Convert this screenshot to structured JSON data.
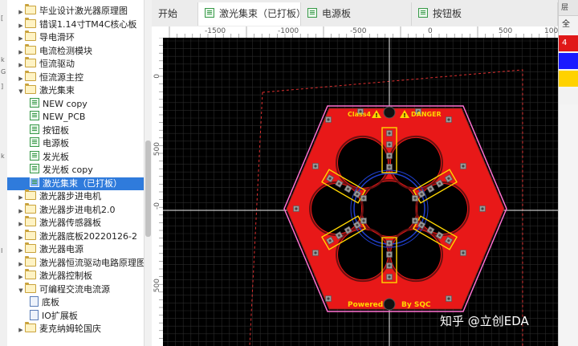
{
  "tree": {
    "items": [
      {
        "label": "毕业设计激光器原理图",
        "type": "folder",
        "level": 1,
        "expanded": false,
        "selected": false
      },
      {
        "label": "错误1.14寸TM4C核心板",
        "type": "folder",
        "level": 1,
        "expanded": false,
        "selected": false
      },
      {
        "label": "导电滑环",
        "type": "folder",
        "level": 1,
        "expanded": false,
        "selected": false
      },
      {
        "label": "电流检测模块",
        "type": "folder",
        "level": 1,
        "expanded": false,
        "selected": false
      },
      {
        "label": "恒流驱动",
        "type": "folder",
        "level": 1,
        "expanded": false,
        "selected": false
      },
      {
        "label": "恒流源主控",
        "type": "folder",
        "level": 1,
        "expanded": false,
        "selected": false
      },
      {
        "label": "激光集束",
        "type": "folder",
        "level": 1,
        "expanded": true,
        "selected": false
      },
      {
        "label": "NEW copy",
        "type": "pcb",
        "level": 2,
        "selected": false
      },
      {
        "label": "NEW_PCB",
        "type": "pcb",
        "level": 2,
        "selected": false
      },
      {
        "label": "按钮板",
        "type": "pcb",
        "level": 2,
        "selected": false
      },
      {
        "label": "电源板",
        "type": "pcb",
        "level": 2,
        "selected": false
      },
      {
        "label": "发光板",
        "type": "pcb",
        "level": 2,
        "selected": false
      },
      {
        "label": "发光板 copy",
        "type": "pcb",
        "level": 2,
        "selected": false
      },
      {
        "label": "激光集束（已打板）",
        "type": "pcb",
        "level": 2,
        "selected": true
      },
      {
        "label": "激光器步进电机",
        "type": "folder",
        "level": 1,
        "expanded": false,
        "selected": false
      },
      {
        "label": "激光器步进电机2.0",
        "type": "folder",
        "level": 1,
        "expanded": false,
        "selected": false
      },
      {
        "label": "激光器传感器板",
        "type": "folder",
        "level": 1,
        "expanded": false,
        "selected": false
      },
      {
        "label": "激光器底板20220126-2",
        "type": "folder",
        "level": 1,
        "expanded": false,
        "selected": false
      },
      {
        "label": "激光器电源",
        "type": "folder",
        "level": 1,
        "expanded": false,
        "selected": false
      },
      {
        "label": "激光器恒流驱动电路原理图",
        "type": "folder",
        "level": 1,
        "expanded": false,
        "selected": false
      },
      {
        "label": "激光器控制板",
        "type": "folder",
        "level": 1,
        "expanded": false,
        "selected": false
      },
      {
        "label": "可编程交流电流源",
        "type": "folder",
        "level": 1,
        "expanded": true,
        "selected": false
      },
      {
        "label": "底板",
        "type": "sch",
        "level": 2,
        "selected": false
      },
      {
        "label": "IO扩展板",
        "type": "sch",
        "level": 2,
        "selected": false
      },
      {
        "label": "麦克纳姆轮国庆",
        "type": "folder",
        "level": 1,
        "expanded": false,
        "selected": false
      }
    ]
  },
  "left_strip": {
    "marks": [
      "[",
      "k",
      "G",
      "]",
      "k",
      "I"
    ]
  },
  "tabs": [
    {
      "label": "开始",
      "icon": "none",
      "active": false
    },
    {
      "label": "激光集束（已打板）",
      "icon": "pcb",
      "active": true
    },
    {
      "label": "电源板",
      "icon": "pcb",
      "active": false
    },
    {
      "label": "按钮板",
      "icon": "pcb",
      "active": false
    }
  ],
  "ruler": {
    "top_labels": [
      "-1500",
      "-1000",
      "-500",
      "0",
      "500",
      "1000"
    ],
    "left_labels": [
      "0",
      "500",
      "-0",
      "500"
    ]
  },
  "right_panel": {
    "header": "层",
    "layers": [
      {
        "color": "#f2f2f2",
        "text": "全"
      },
      {
        "color": "#e01818",
        "text": "4"
      },
      {
        "color": "#1a1aff",
        "text": ""
      },
      {
        "color": "#ffd200",
        "text": ""
      },
      {
        "color": "#f2f2f2",
        "text": ""
      }
    ]
  },
  "pcb": {
    "board_color": "#e81818",
    "outline_color": "#ff70d0",
    "silk_color": "#ffd700",
    "label_class": "Class4",
    "label_danger": "DANGER",
    "label_powered": "Powered",
    "label_by": "By SQC"
  },
  "watermark": "知乎 @立创EDA"
}
